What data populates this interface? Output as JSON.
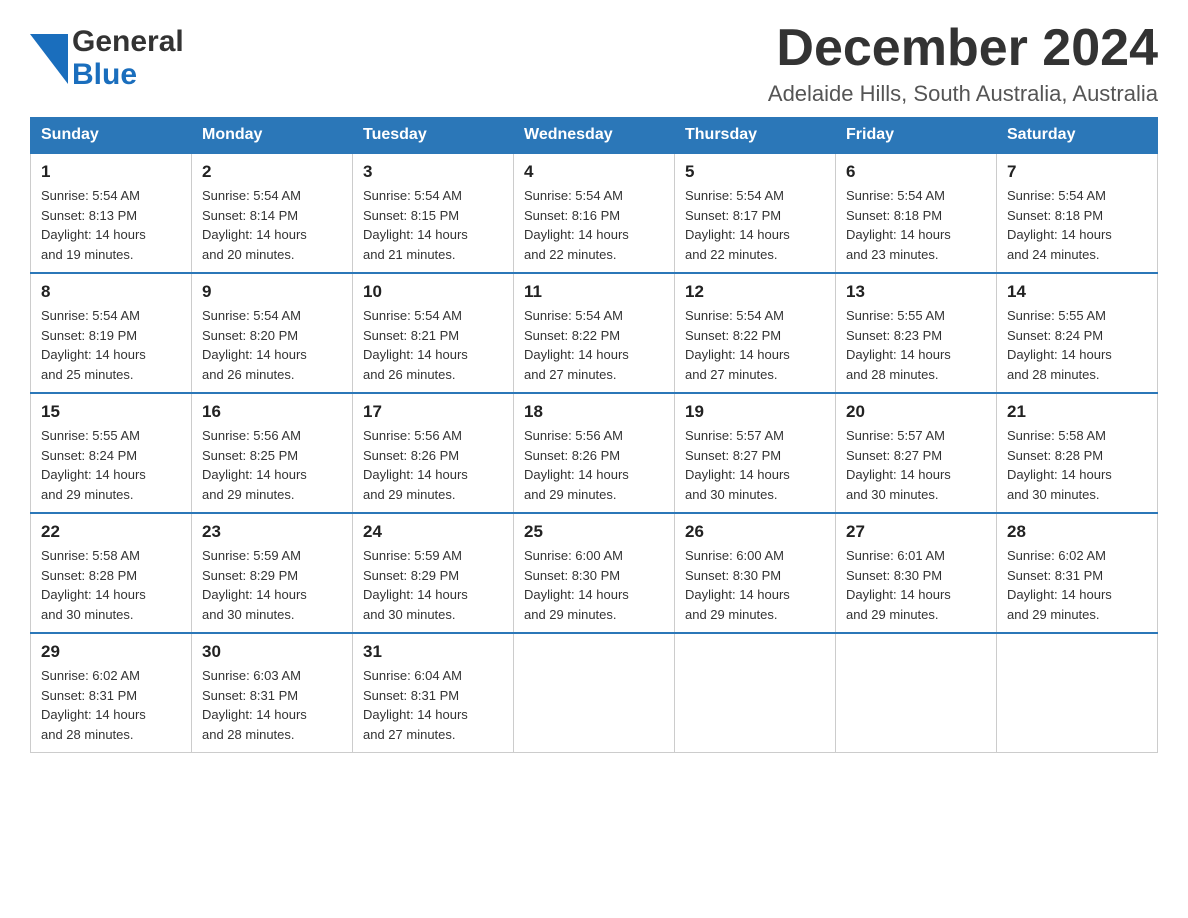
{
  "logo": {
    "general": "General",
    "blue": "Blue",
    "alt": "GeneralBlue logo"
  },
  "title": "December 2024",
  "subtitle": "Adelaide Hills, South Australia, Australia",
  "days_of_week": [
    "Sunday",
    "Monday",
    "Tuesday",
    "Wednesday",
    "Thursday",
    "Friday",
    "Saturday"
  ],
  "weeks": [
    [
      {
        "day": "1",
        "sunrise": "5:54 AM",
        "sunset": "8:13 PM",
        "daylight": "14 hours and 19 minutes."
      },
      {
        "day": "2",
        "sunrise": "5:54 AM",
        "sunset": "8:14 PM",
        "daylight": "14 hours and 20 minutes."
      },
      {
        "day": "3",
        "sunrise": "5:54 AM",
        "sunset": "8:15 PM",
        "daylight": "14 hours and 21 minutes."
      },
      {
        "day": "4",
        "sunrise": "5:54 AM",
        "sunset": "8:16 PM",
        "daylight": "14 hours and 22 minutes."
      },
      {
        "day": "5",
        "sunrise": "5:54 AM",
        "sunset": "8:17 PM",
        "daylight": "14 hours and 22 minutes."
      },
      {
        "day": "6",
        "sunrise": "5:54 AM",
        "sunset": "8:18 PM",
        "daylight": "14 hours and 23 minutes."
      },
      {
        "day": "7",
        "sunrise": "5:54 AM",
        "sunset": "8:18 PM",
        "daylight": "14 hours and 24 minutes."
      }
    ],
    [
      {
        "day": "8",
        "sunrise": "5:54 AM",
        "sunset": "8:19 PM",
        "daylight": "14 hours and 25 minutes."
      },
      {
        "day": "9",
        "sunrise": "5:54 AM",
        "sunset": "8:20 PM",
        "daylight": "14 hours and 26 minutes."
      },
      {
        "day": "10",
        "sunrise": "5:54 AM",
        "sunset": "8:21 PM",
        "daylight": "14 hours and 26 minutes."
      },
      {
        "day": "11",
        "sunrise": "5:54 AM",
        "sunset": "8:22 PM",
        "daylight": "14 hours and 27 minutes."
      },
      {
        "day": "12",
        "sunrise": "5:54 AM",
        "sunset": "8:22 PM",
        "daylight": "14 hours and 27 minutes."
      },
      {
        "day": "13",
        "sunrise": "5:55 AM",
        "sunset": "8:23 PM",
        "daylight": "14 hours and 28 minutes."
      },
      {
        "day": "14",
        "sunrise": "5:55 AM",
        "sunset": "8:24 PM",
        "daylight": "14 hours and 28 minutes."
      }
    ],
    [
      {
        "day": "15",
        "sunrise": "5:55 AM",
        "sunset": "8:24 PM",
        "daylight": "14 hours and 29 minutes."
      },
      {
        "day": "16",
        "sunrise": "5:56 AM",
        "sunset": "8:25 PM",
        "daylight": "14 hours and 29 minutes."
      },
      {
        "day": "17",
        "sunrise": "5:56 AM",
        "sunset": "8:26 PM",
        "daylight": "14 hours and 29 minutes."
      },
      {
        "day": "18",
        "sunrise": "5:56 AM",
        "sunset": "8:26 PM",
        "daylight": "14 hours and 29 minutes."
      },
      {
        "day": "19",
        "sunrise": "5:57 AM",
        "sunset": "8:27 PM",
        "daylight": "14 hours and 30 minutes."
      },
      {
        "day": "20",
        "sunrise": "5:57 AM",
        "sunset": "8:27 PM",
        "daylight": "14 hours and 30 minutes."
      },
      {
        "day": "21",
        "sunrise": "5:58 AM",
        "sunset": "8:28 PM",
        "daylight": "14 hours and 30 minutes."
      }
    ],
    [
      {
        "day": "22",
        "sunrise": "5:58 AM",
        "sunset": "8:28 PM",
        "daylight": "14 hours and 30 minutes."
      },
      {
        "day": "23",
        "sunrise": "5:59 AM",
        "sunset": "8:29 PM",
        "daylight": "14 hours and 30 minutes."
      },
      {
        "day": "24",
        "sunrise": "5:59 AM",
        "sunset": "8:29 PM",
        "daylight": "14 hours and 30 minutes."
      },
      {
        "day": "25",
        "sunrise": "6:00 AM",
        "sunset": "8:30 PM",
        "daylight": "14 hours and 29 minutes."
      },
      {
        "day": "26",
        "sunrise": "6:00 AM",
        "sunset": "8:30 PM",
        "daylight": "14 hours and 29 minutes."
      },
      {
        "day": "27",
        "sunrise": "6:01 AM",
        "sunset": "8:30 PM",
        "daylight": "14 hours and 29 minutes."
      },
      {
        "day": "28",
        "sunrise": "6:02 AM",
        "sunset": "8:31 PM",
        "daylight": "14 hours and 29 minutes."
      }
    ],
    [
      {
        "day": "29",
        "sunrise": "6:02 AM",
        "sunset": "8:31 PM",
        "daylight": "14 hours and 28 minutes."
      },
      {
        "day": "30",
        "sunrise": "6:03 AM",
        "sunset": "8:31 PM",
        "daylight": "14 hours and 28 minutes."
      },
      {
        "day": "31",
        "sunrise": "6:04 AM",
        "sunset": "8:31 PM",
        "daylight": "14 hours and 27 minutes."
      },
      null,
      null,
      null,
      null
    ]
  ],
  "labels": {
    "sunrise": "Sunrise:",
    "sunset": "Sunset:",
    "daylight": "Daylight:"
  },
  "colors": {
    "header_bg": "#2b77b8",
    "header_text": "#ffffff",
    "border": "#2b77b8",
    "cell_border": "#cccccc"
  }
}
